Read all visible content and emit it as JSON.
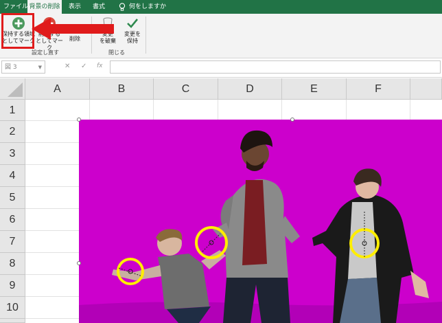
{
  "ribbon_tabs": [
    {
      "label": "ファイル"
    },
    {
      "label": "背景の削除"
    },
    {
      "label": "表示"
    },
    {
      "label": "書式"
    },
    {
      "label": "何をしますか"
    }
  ],
  "ribbon": {
    "mark_keep": "保持する領域\nとしてマーク",
    "mark_remove": "削除する\nとしてマーク",
    "delete_label": "削除",
    "discard": "変更\nを破棄",
    "keep_changes": "変更を\n保持",
    "group_refine": "設定し直す",
    "group_close": "閉じる"
  },
  "formula_bar": {
    "name_box": "図 3",
    "cancel": "✕",
    "enter": "✓",
    "fx": "fx",
    "content": ""
  },
  "columns": [
    "A",
    "B",
    "C",
    "D",
    "E",
    "F"
  ],
  "rows": [
    "1",
    "2",
    "3",
    "4",
    "5",
    "6",
    "7",
    "8",
    "9",
    "10"
  ],
  "colors": {
    "excel_green": "#217346",
    "background_removal": "#cc00cc",
    "annotation_red": "#e01b1b",
    "annotation_yellow": "#ffee00"
  },
  "icons": {
    "mark_keep": "plus-circle-icon",
    "mark_remove": "minus-circle-icon",
    "discard": "trash-icon",
    "keep": "checkmark-icon",
    "tell_me": "lightbulb-icon"
  }
}
